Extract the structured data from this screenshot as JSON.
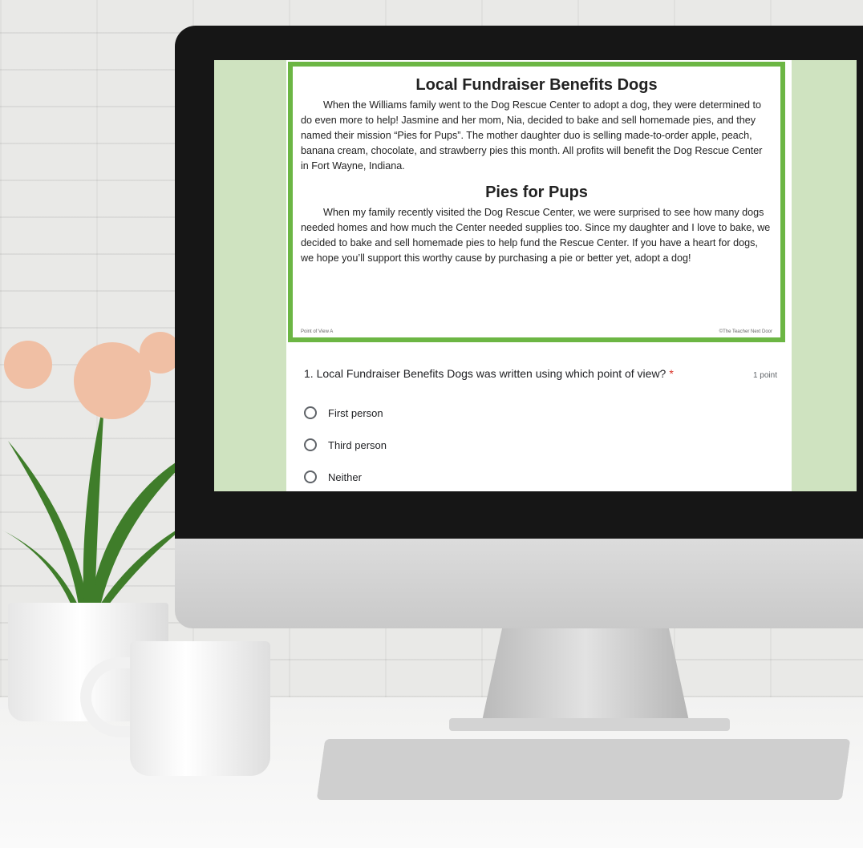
{
  "article1": {
    "title": "Local Fundraiser Benefits Dogs",
    "body": "When the Williams family went to the Dog Rescue Center to adopt a dog, they were determined to do even more to help! Jasmine and her mom, Nia, decided to bake and sell homemade pies, and they named their mission “Pies for Pups”. The mother daughter duo is selling made-to-order apple, peach, banana cream, chocolate, and strawberry pies this month. All profits will benefit the Dog Rescue Center in Fort Wayne, Indiana."
  },
  "article2": {
    "title": "Pies for Pups",
    "body": "When my family recently visited the Dog Rescue Center, we were surprised to see how many dogs needed homes and how much the Center needed supplies too. Since my daughter and I love to bake, we decided to bake and sell homemade pies to help fund the Rescue Center.  If you have a heart for dogs, we hope you’ll support this worthy cause by purchasing a pie or better yet, adopt a dog!"
  },
  "slide_footer": {
    "left": "Point of View A",
    "right": "©The Teacher Next Door"
  },
  "question": {
    "text": "1. Local Fundraiser Benefits Dogs was written using which point of view?",
    "required_mark": "*",
    "points": "1 point",
    "options": [
      "First person",
      "Third person",
      "Neither"
    ]
  },
  "colors": {
    "screen_bg": "#cfe3c0",
    "slide_border": "#6cb644",
    "required": "#d93025"
  }
}
